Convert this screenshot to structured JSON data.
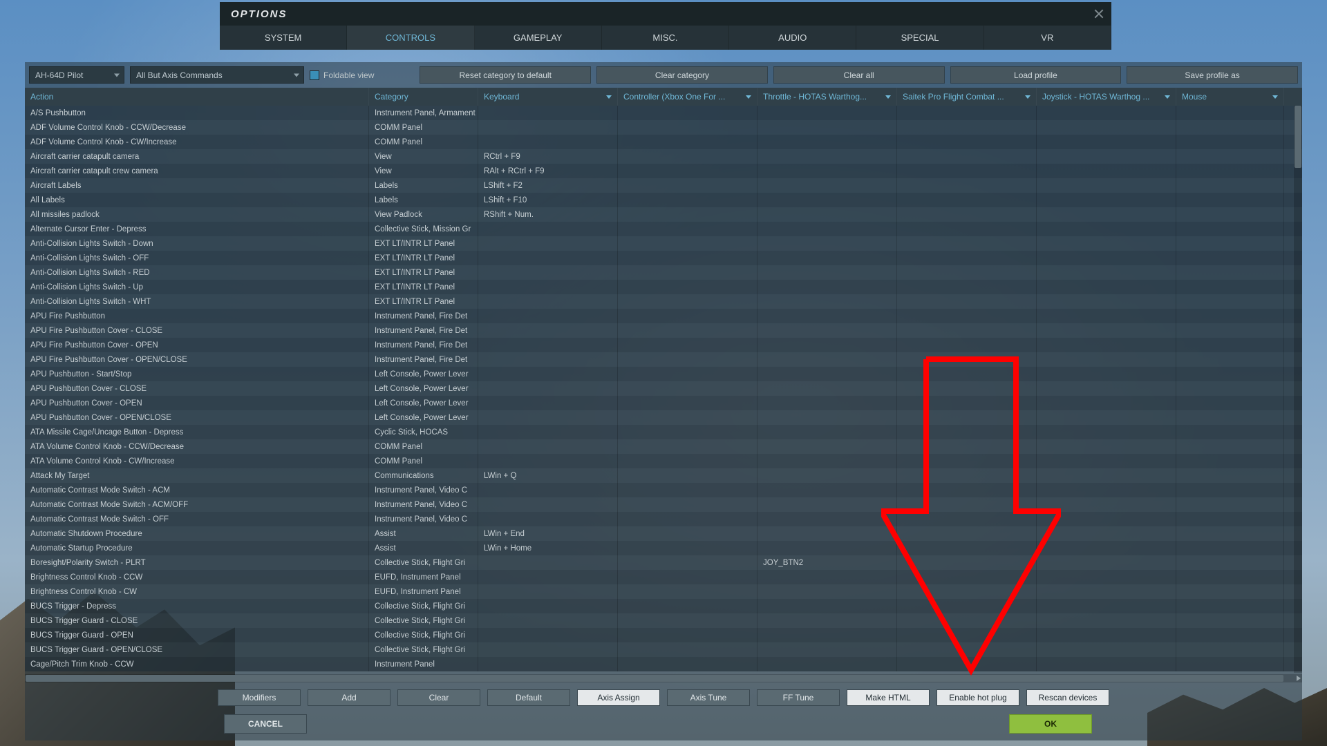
{
  "window": {
    "title": "OPTIONS"
  },
  "tabs": {
    "items": [
      "SYSTEM",
      "CONTROLS",
      "GAMEPLAY",
      "MISC.",
      "AUDIO",
      "SPECIAL",
      "VR"
    ],
    "activeIndex": 1
  },
  "toolbar": {
    "pilot": "AH-64D Pilot",
    "filter": "All But Axis Commands",
    "foldable": "Foldable view",
    "reset": "Reset category to default",
    "clear_cat": "Clear category",
    "clear_all": "Clear all",
    "load": "Load profile",
    "save": "Save profile as"
  },
  "columns": [
    "Action",
    "Category",
    "Keyboard",
    "Controller (Xbox One For ...",
    "Throttle - HOTAS Warthog...",
    "Saitek Pro Flight Combat ...",
    "Joystick - HOTAS Warthog ...",
    "Mouse"
  ],
  "rows": [
    {
      "action": "A/S Pushbutton",
      "category": "Instrument Panel, Armament"
    },
    {
      "action": "ADF Volume Control Knob - CCW/Decrease",
      "category": "COMM Panel"
    },
    {
      "action": "ADF Volume Control Knob - CW/Increase",
      "category": "COMM Panel"
    },
    {
      "action": "Aircraft carrier catapult camera",
      "category": "View",
      "keyboard": "RCtrl + F9"
    },
    {
      "action": "Aircraft carrier catapult crew camera",
      "category": "View",
      "keyboard": "RAlt + RCtrl + F9"
    },
    {
      "action": "Aircraft Labels",
      "category": "Labels",
      "keyboard": "LShift + F2"
    },
    {
      "action": "All Labels",
      "category": "Labels",
      "keyboard": "LShift + F10"
    },
    {
      "action": "All missiles padlock",
      "category": "View Padlock",
      "keyboard": "RShift + Num."
    },
    {
      "action": "Alternate Cursor Enter - Depress",
      "category": "Collective Stick, Mission Gr"
    },
    {
      "action": "Anti-Collision Lights Switch - Down",
      "category": "EXT LT/INTR LT Panel"
    },
    {
      "action": "Anti-Collision Lights Switch - OFF",
      "category": "EXT LT/INTR LT Panel"
    },
    {
      "action": "Anti-Collision Lights Switch - RED",
      "category": "EXT LT/INTR LT Panel"
    },
    {
      "action": "Anti-Collision Lights Switch - Up",
      "category": "EXT LT/INTR LT Panel"
    },
    {
      "action": "Anti-Collision Lights Switch - WHT",
      "category": "EXT LT/INTR LT Panel"
    },
    {
      "action": "APU Fire Pushbutton",
      "category": "Instrument Panel, Fire Det"
    },
    {
      "action": "APU Fire Pushbutton Cover - CLOSE",
      "category": "Instrument Panel, Fire Det"
    },
    {
      "action": "APU Fire Pushbutton Cover - OPEN",
      "category": "Instrument Panel, Fire Det"
    },
    {
      "action": "APU Fire Pushbutton Cover - OPEN/CLOSE",
      "category": "Instrument Panel, Fire Det"
    },
    {
      "action": "APU Pushbutton - Start/Stop",
      "category": "Left Console, Power Lever"
    },
    {
      "action": "APU Pushbutton Cover - CLOSE",
      "category": "Left Console, Power Lever"
    },
    {
      "action": "APU Pushbutton Cover - OPEN",
      "category": "Left Console, Power Lever"
    },
    {
      "action": "APU Pushbutton Cover - OPEN/CLOSE",
      "category": "Left Console, Power Lever"
    },
    {
      "action": "ATA Missile Cage/Uncage Button - Depress",
      "category": "Cyclic Stick, HOCAS"
    },
    {
      "action": "ATA Volume Control Knob - CCW/Decrease",
      "category": "COMM Panel"
    },
    {
      "action": "ATA Volume Control Knob - CW/Increase",
      "category": "COMM Panel"
    },
    {
      "action": "Attack My Target",
      "category": "Communications",
      "keyboard": "LWin + Q"
    },
    {
      "action": "Automatic Contrast Mode Switch - ACM",
      "category": "Instrument Panel, Video C"
    },
    {
      "action": "Automatic Contrast Mode Switch - ACM/OFF",
      "category": "Instrument Panel, Video C"
    },
    {
      "action": "Automatic Contrast Mode Switch - OFF",
      "category": "Instrument Panel, Video C"
    },
    {
      "action": "Automatic Shutdown Procedure",
      "category": "Assist",
      "keyboard": "LWin + End"
    },
    {
      "action": "Automatic Startup Procedure",
      "category": "Assist",
      "keyboard": "LWin + Home"
    },
    {
      "action": "Boresight/Polarity Switch - PLRT",
      "category": "Collective Stick, Flight Gri",
      "throttle": "JOY_BTN2"
    },
    {
      "action": "Brightness Control Knob - CCW",
      "category": "EUFD, Instrument Panel"
    },
    {
      "action": "Brightness Control Knob - CW",
      "category": "EUFD, Instrument Panel"
    },
    {
      "action": "BUCS Trigger - Depress",
      "category": "Collective Stick, Flight Gri"
    },
    {
      "action": "BUCS Trigger Guard - CLOSE",
      "category": "Collective Stick, Flight Gri"
    },
    {
      "action": "BUCS Trigger Guard - OPEN",
      "category": "Collective Stick, Flight Gri"
    },
    {
      "action": "BUCS Trigger Guard - OPEN/CLOSE",
      "category": "Collective Stick, Flight Gri"
    },
    {
      "action": "Cage/Pitch Trim Knob - CCW",
      "category": "Instrument Panel"
    }
  ],
  "bottom": {
    "modifiers": "Modifiers",
    "add": "Add",
    "clear": "Clear",
    "default": "Default",
    "axis_assign": "Axis Assign",
    "axis_tune": "Axis Tune",
    "ff_tune": "FF Tune",
    "make_html": "Make HTML",
    "hotplug": "Enable hot plug",
    "rescan": "Rescan devices"
  },
  "confirm": {
    "cancel": "CANCEL",
    "ok": "OK"
  }
}
